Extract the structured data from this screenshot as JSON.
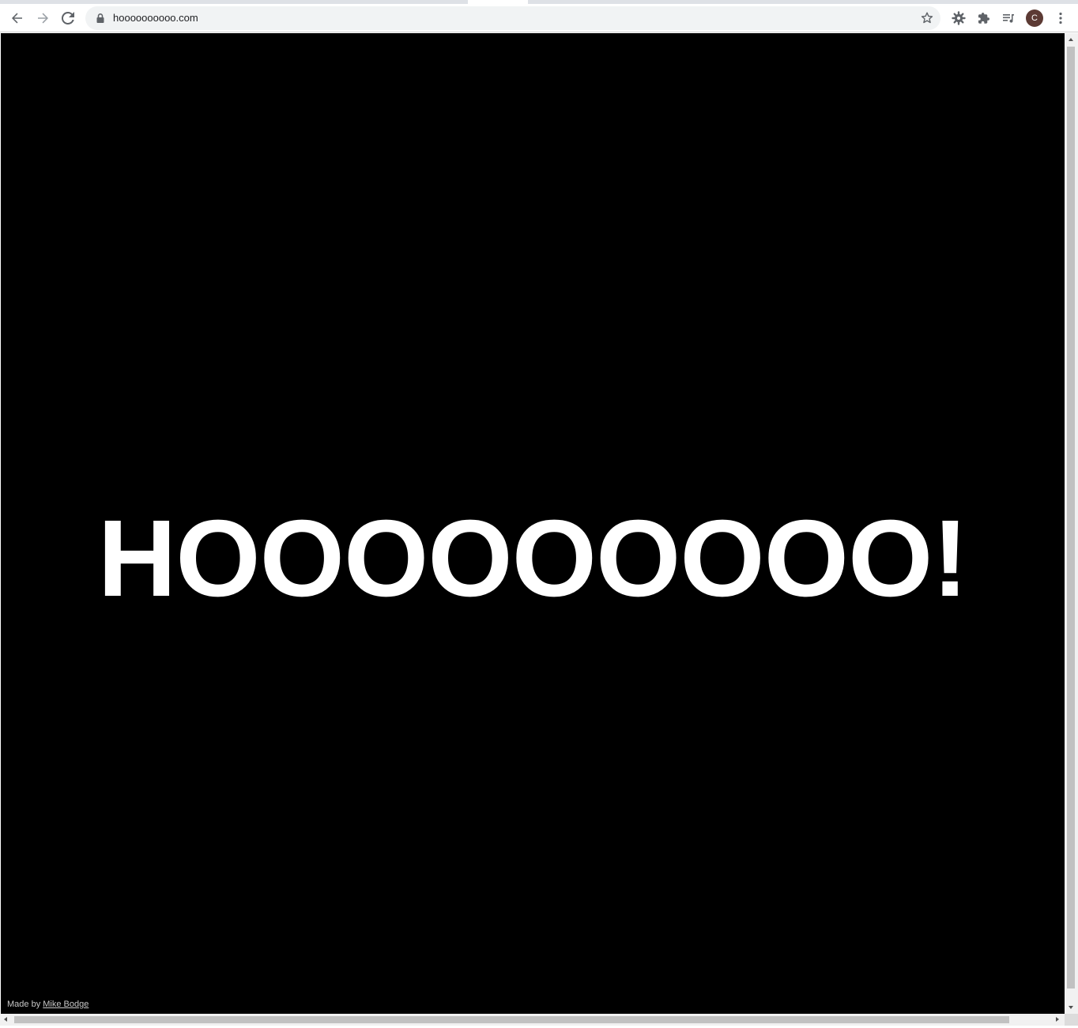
{
  "browser": {
    "address_bar": {
      "url": "hoooooooooo.com"
    },
    "toolbar_icons": [
      "back-icon",
      "forward-icon",
      "reload-icon",
      "lock-icon",
      "bookmark-star-icon",
      "extension-gear-icon",
      "extensions-puzzle-icon",
      "media-queue-icon",
      "menu-kebab-icon"
    ],
    "profile": {
      "initial": "C",
      "color": "#5c3a34"
    }
  },
  "page": {
    "headline": "HOOOOOOOOO!",
    "credit_prefix": "Made by ",
    "credit_link": "Mike Bodge",
    "background_color": "#000000",
    "text_color": "#ffffff"
  }
}
